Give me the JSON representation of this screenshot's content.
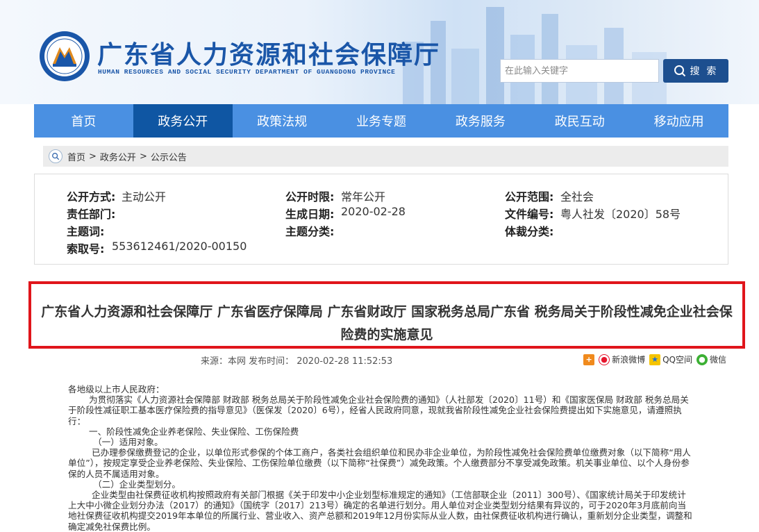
{
  "header": {
    "site_title": "广东省人力资源和社会保障厅",
    "site_subtitle": "HUMAN RESOURCES AND SOCIAL SECURITY DEPARTMENT OF GUANGDONG PROVINCE",
    "search_placeholder": "在此输入关键字",
    "search_button": "搜 索"
  },
  "nav": {
    "items": [
      "首页",
      "政务公开",
      "政策法规",
      "业务专题",
      "政务服务",
      "政民互动",
      "移动应用"
    ],
    "active": "政务公开"
  },
  "breadcrumb": [
    "首页",
    "政务公开",
    "公示公告"
  ],
  "meta": {
    "open_method_label": "公开方式:",
    "open_method": "主动公开",
    "open_period_label": "公开时限:",
    "open_period": "常年公开",
    "open_scope_label": "公开范围:",
    "open_scope": "全社会",
    "dept_label": "责任部门:",
    "dept": "",
    "gen_date_label": "生成日期:",
    "gen_date": "2020-02-28",
    "doc_no_label": "文件编号:",
    "doc_no": "粤人社发〔2020〕58号",
    "topic_label": "主题词:",
    "topic": "",
    "topic_class_label": "主题分类:",
    "topic_class": "",
    "genre_label": "体裁分类:",
    "genre": "",
    "index_label": "索取号:",
    "index": "553612461/2020-00150"
  },
  "article": {
    "title": "广东省人力资源和社会保障厅 广东省医疗保障局 广东省财政厅 国家税务总局广东省 税务局关于阶段性减免企业社会保险费的实施意见",
    "source": "来源：本网   发布时间： 2020-02-28 11:52:53",
    "share": [
      "新浪微博",
      "QQ空间",
      "微信"
    ],
    "paragraphs": [
      "各地级以上市人民政府：",
      "为贯彻落实《人力资源社会保障部 财政部 税务总局关于阶段性减免企业社会保险费的通知》（人社部发〔2020〕11号）和《国家医保局 财政部 税务总局关于阶段性减征职工基本医疗保险费的指导意见》（医保发〔2020〕6号），经省人民政府同意，现就我省阶段性减免企业社会保险费提出如下实施意见，请遵照执行：",
      "一、阶段性减免企业养老保险、失业保险、工伤保险费",
      "（一）适用对象。",
      "已办理参保缴费登记的企业，以单位形式参保的个体工商户，各类社会组织单位和民办非企业单位，为阶段性减免社会保险费单位缴费对象（以下简称“用人单位”），按规定享受企业养老保险、失业保险、工伤保险单位缴费（以下简称“社保费”）减免政策。个人缴费部分不享受减免政策。机关事业单位、以个人身份参保的人员不属适用对象。",
      "（二）企业类型划分。",
      "企业类型由社保费征收机构按照政府有关部门根据《关于印发中小企业划型标准规定的通知》（工信部联企业〔2011〕300号）、《国家统计局关于印发统计上大中小微企业划分办法（2017）的通知》（国统字〔2017〕213号）确定的名单进行划分。用人单位对企业类型划分结果有异议的，可于2020年3月底前向当地社保费征收机构提交2019年本单位的所属行业、营业收入、资产总额和2019年12月份实际从业人数，由社保费征收机构进行确认，重新划分企业类型，调整和确定减免社保费比例。"
    ]
  },
  "colors": {
    "nav": "#4a90e2",
    "nav_active": "#0f56a3",
    "title_border": "#e0151b",
    "brand": "#1a56a8"
  }
}
